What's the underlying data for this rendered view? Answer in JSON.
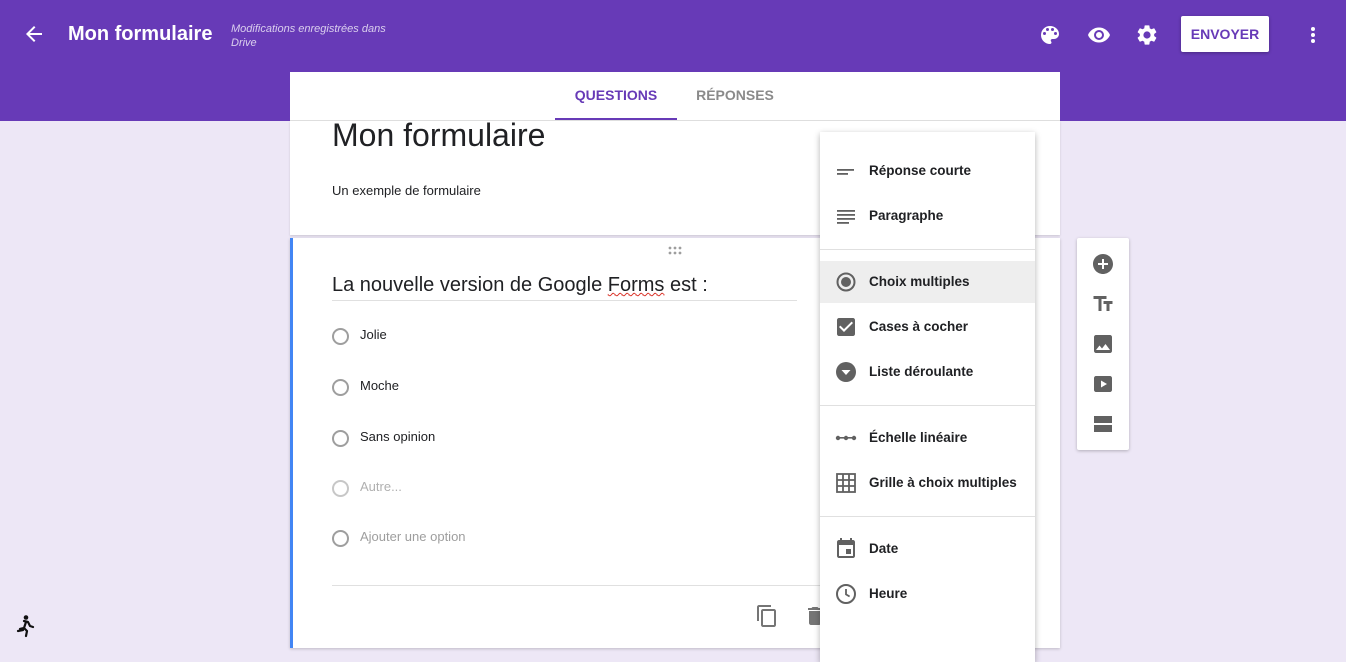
{
  "header": {
    "title": "Mon formulaire",
    "save_status": "Modifications enregistrées dans Drive",
    "send_label": "ENVOYER",
    "icons": [
      "arrow-left-icon",
      "palette-icon",
      "eye-icon",
      "gear-icon",
      "more-vert-icon"
    ]
  },
  "tabs": [
    {
      "label": "QUESTIONS",
      "active": true
    },
    {
      "label": "RÉPONSES",
      "active": false
    }
  ],
  "form": {
    "title": "Mon formulaire",
    "description": "Un exemple de formulaire"
  },
  "question": {
    "title_before": "La nouvelle version de Google ",
    "title_underlined": "Forms",
    "title_after": " est :",
    "options": [
      {
        "label": "Jolie"
      },
      {
        "label": "Moche"
      },
      {
        "label": "Sans opinion"
      }
    ],
    "other_placeholder": "Autre...",
    "add_option_label": "Ajouter une option"
  },
  "type_menu": {
    "items": [
      {
        "label": "Réponse courte",
        "icon": "short-text-icon"
      },
      {
        "label": "Paragraphe",
        "icon": "paragraph-icon"
      },
      {
        "label": "Choix multiples",
        "icon": "radio-button-icon",
        "selected": true
      },
      {
        "label": "Cases à cocher",
        "icon": "checkbox-icon"
      },
      {
        "label": "Liste déroulante",
        "icon": "dropdown-icon"
      },
      {
        "label": "Échelle linéaire",
        "icon": "linear-scale-icon"
      },
      {
        "label": "Grille à choix multiples",
        "icon": "grid-icon"
      },
      {
        "label": "Date",
        "icon": "calendar-icon"
      },
      {
        "label": "Heure",
        "icon": "clock-icon"
      }
    ]
  },
  "side_toolbar": {
    "icons": [
      "add-circle-icon",
      "title-text-icon",
      "image-icon",
      "video-icon",
      "section-icon"
    ]
  },
  "colors": {
    "brand": "#673ab7",
    "background": "#ede7f6",
    "accent_blue": "#4285f4"
  }
}
